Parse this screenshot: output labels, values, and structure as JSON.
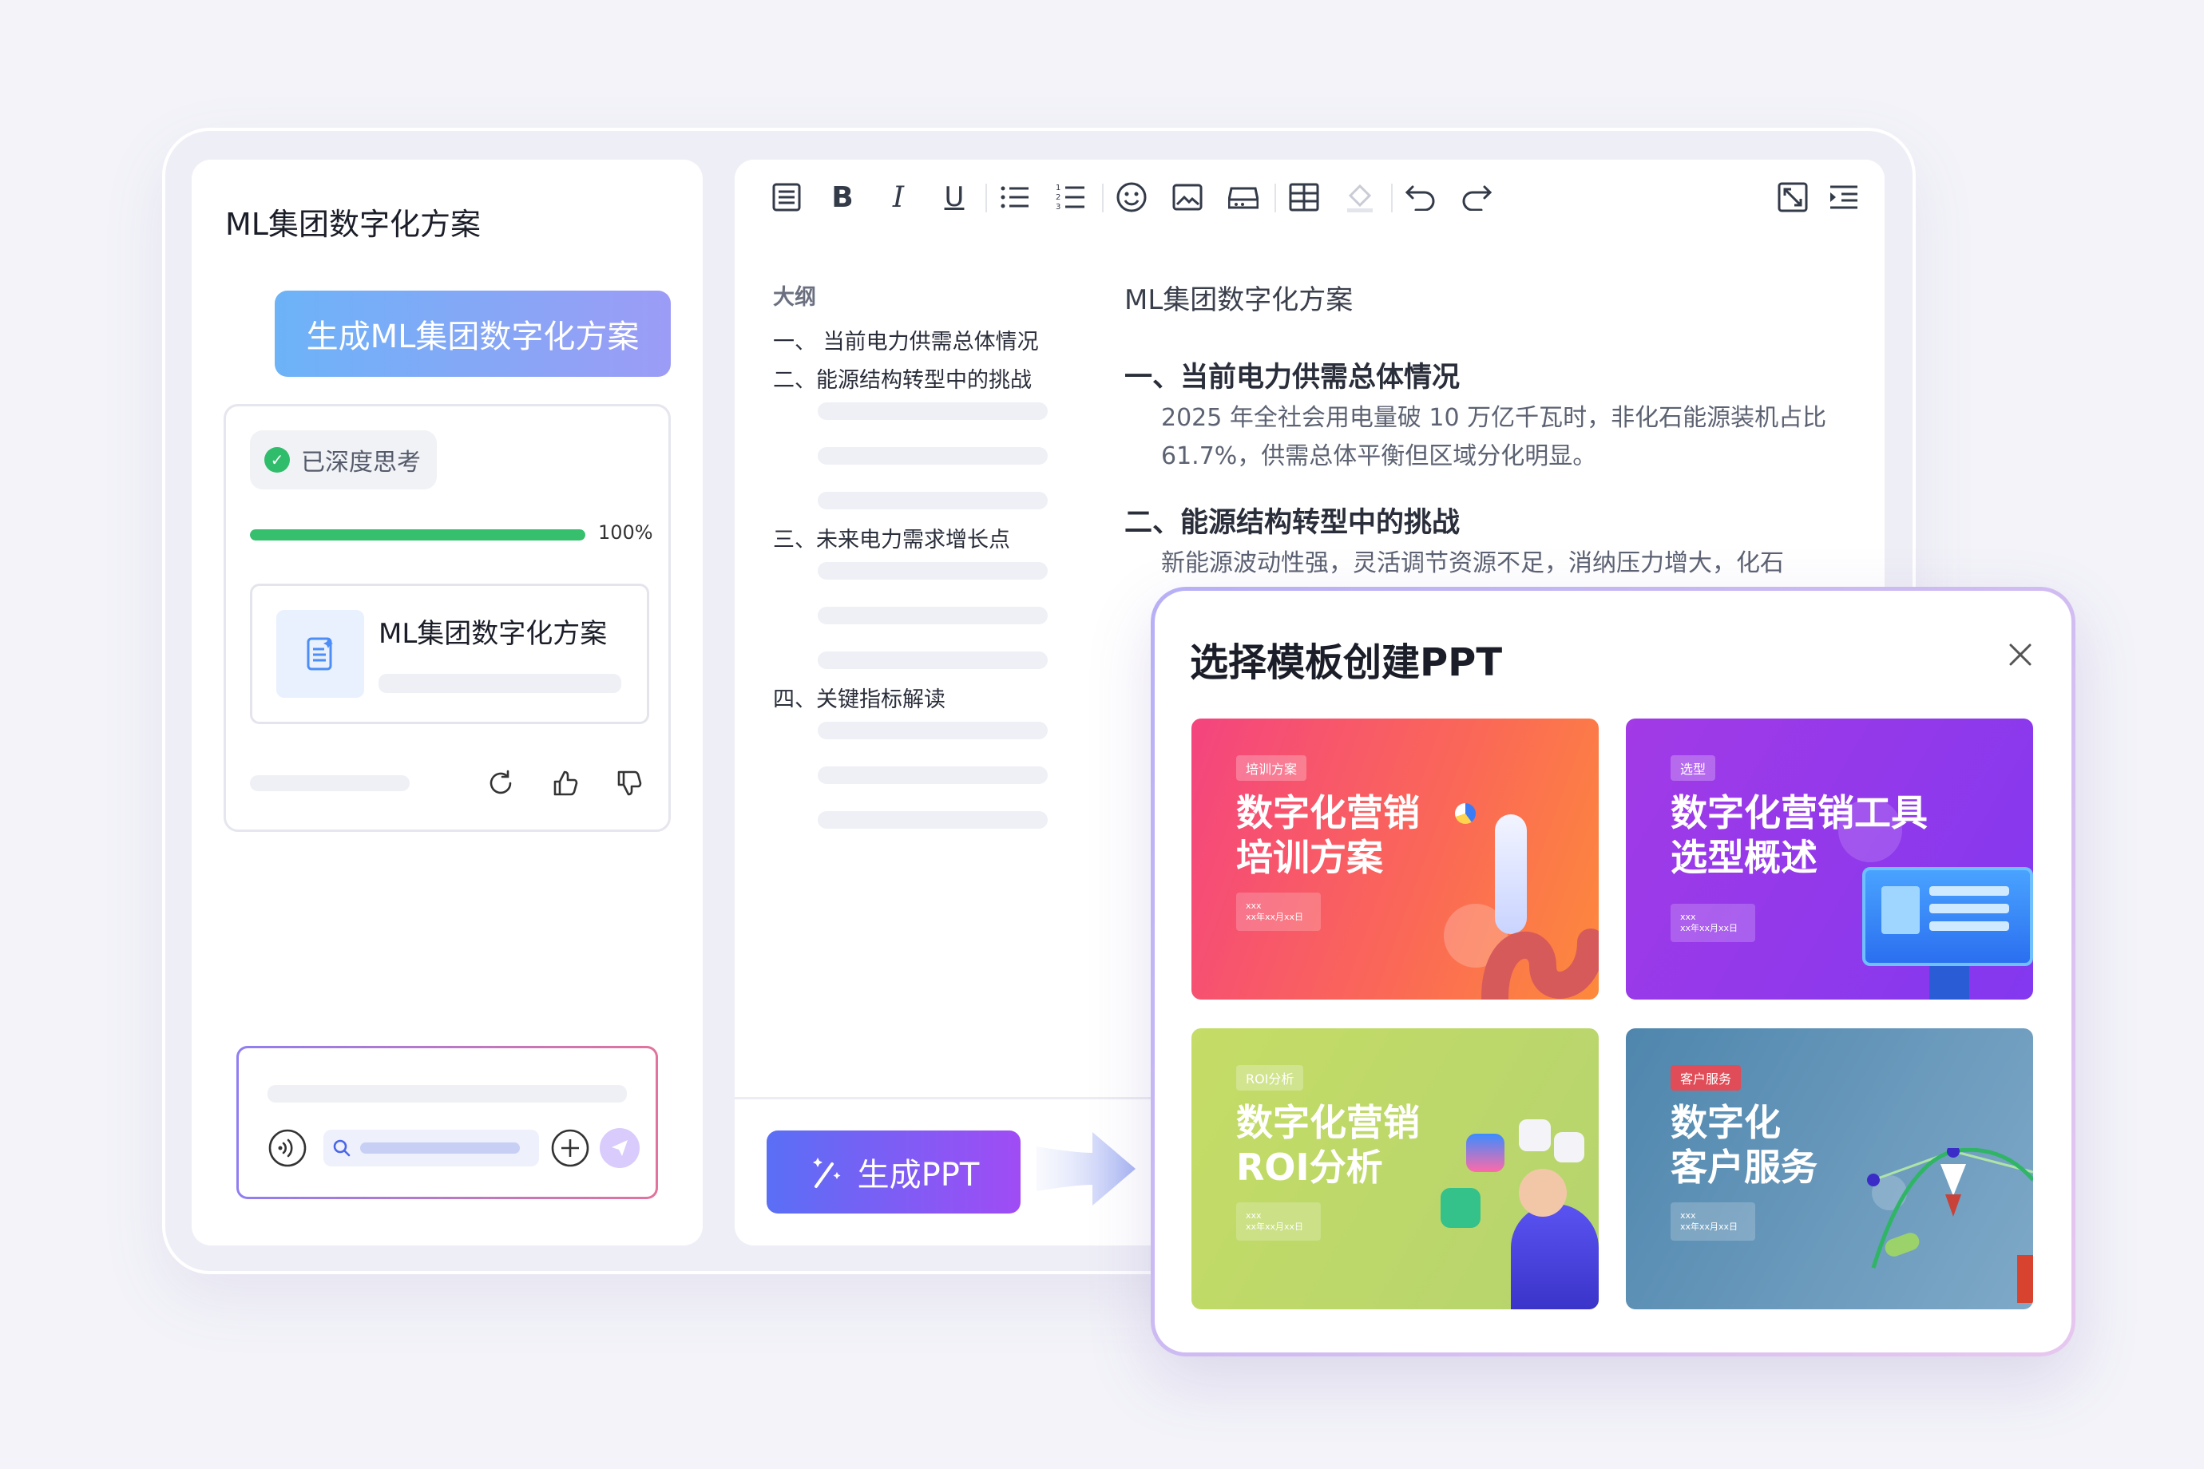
{
  "chat": {
    "title": "ML集团数字化方案",
    "generate_button": "生成ML集团数字化方案",
    "thinking_chip": "已深度思考",
    "progress_value": 1.0,
    "progress_text": "100%",
    "doc_card_title": "ML集团数字化方案"
  },
  "editor": {
    "outline_label": "大纲",
    "outline": [
      "一、 当前电力供需总体情况",
      "二、能源结构转型中的挑战",
      "三、未来电力需求增长点",
      "四、关键指标解读"
    ],
    "doc_title": "ML集团数字化方案",
    "sections": [
      {
        "heading": "一、当前电力供需总体情况",
        "body": "2025 年全社会用电量破 10 万亿千瓦时，非化石能源装机占比 61.7%，供需总体平衡但区域分化明显。"
      },
      {
        "heading": "二、能源结构转型中的挑战",
        "body": "新能源波动性强，灵活调节资源不足，消纳压力增大，化石"
      }
    ],
    "generate_ppt_button": "生成PPT"
  },
  "modal": {
    "title": "选择模板创建PPT",
    "templates": [
      {
        "tag": "培训方案",
        "title_line1": "数字化营销",
        "title_line2": "培训方案",
        "meta1": "xxx",
        "meta2": "xx年xx月xx日"
      },
      {
        "tag": "选型",
        "title_line1": "数字化营销工具",
        "title_line2": "选型概述",
        "meta1": "xxx",
        "meta2": "xx年xx月xx日"
      },
      {
        "tag": "ROI分析",
        "title_line1": "数字化营销",
        "title_line2": "ROI分析",
        "meta1": "xxx",
        "meta2": "xx年xx月xx日"
      },
      {
        "tag": "客户服务",
        "title_line1": "数字化",
        "title_line2": "客户服务",
        "meta1": "xxx",
        "meta2": "xx年xx月xx日"
      }
    ]
  },
  "colors": {
    "accent_purple": "#8b5cf6",
    "progress_green": "#36bf6d",
    "template_pink": "#f5467e",
    "template_purple": "#8a3cf0",
    "template_lime": "#bcd86a",
    "template_teal": "#5a8fb4"
  }
}
